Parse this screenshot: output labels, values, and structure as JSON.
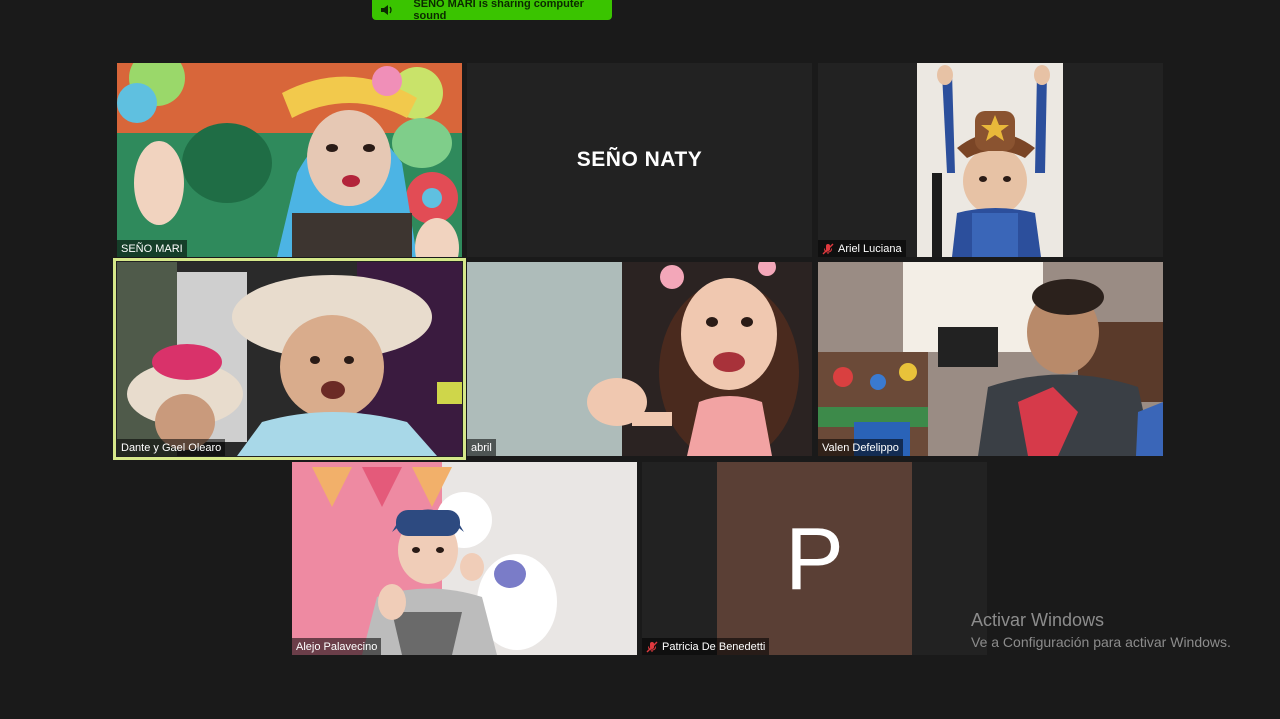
{
  "banner": {
    "text": "SEÑO MARI is sharing computer sound",
    "icon": "speaker-icon",
    "color": "#3ac400"
  },
  "participants": [
    {
      "name": "SEÑO MARI",
      "muted": false,
      "video": true,
      "active": false
    },
    {
      "name": "SEÑO NATY",
      "muted": false,
      "video": false,
      "active": false
    },
    {
      "name": "Ariel Luciana",
      "muted": true,
      "video": true,
      "active": false
    },
    {
      "name": "Dante y Gael Olearo",
      "muted": false,
      "video": true,
      "active": true
    },
    {
      "name": "abril",
      "muted": false,
      "video": true,
      "active": false
    },
    {
      "name": "Valen Defelippo",
      "muted": false,
      "video": true,
      "active": false
    },
    {
      "name": "Alejo Palavecino",
      "muted": false,
      "video": true,
      "active": false
    },
    {
      "name": "Patricia De Benedetti",
      "muted": true,
      "video": false,
      "active": false,
      "avatar_letter": "P",
      "avatar_color": "#5a3f35"
    }
  ],
  "watermark": {
    "title": "Activar Windows",
    "subtitle": "Ve a Configuración para activar Windows."
  },
  "colors": {
    "background": "#1a1a1a",
    "tile": "#222222",
    "active_border": "#d6e88a",
    "muted_icon": "#e0393e"
  }
}
